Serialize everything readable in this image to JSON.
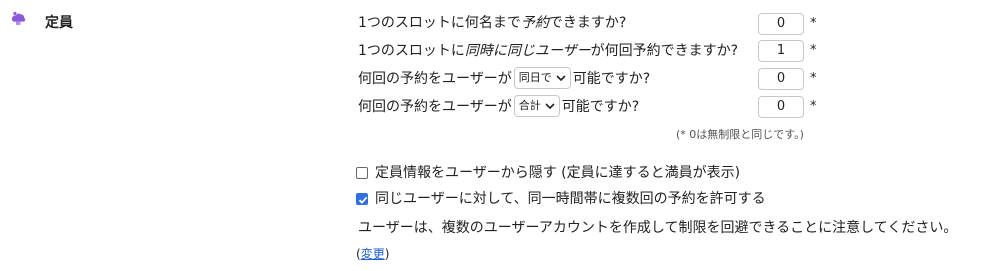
{
  "section": {
    "title": "定員",
    "icon": "puzzle-cloud-icon",
    "icon_color": "#8b5ad8"
  },
  "rows": [
    {
      "text_before": "1つのスロットに何名まで",
      "italic": "予約",
      "text_after": "できますか?",
      "value": "0",
      "required": "*"
    },
    {
      "text_before": "1つのスロットに",
      "italic": "同時に同じユーザー",
      "text_after": "が何回予約できますか?",
      "value": "1",
      "required": "*"
    },
    {
      "text_before": "何回の予約をユーザーが",
      "select_value": "同日で",
      "text_after": "可能ですか?",
      "value": "0",
      "required": "*"
    },
    {
      "text_before": "何回の予約をユーザーが",
      "select_value": "合計",
      "text_after": "可能ですか?",
      "value": "0",
      "required": "*"
    }
  ],
  "note": "(* 0は無制限と同じです。)",
  "checkboxes": [
    {
      "label": "定員情報をユーザーから隠す (定員に達すると満員が表示)",
      "checked": false
    },
    {
      "label": "同じユーザーに対して、同一時間帯に複数回の予約を許可する",
      "checked": true
    }
  ],
  "warning": "ユーザーは、複数のユーザーアカウントを作成して制限を回避できることに注意してください。",
  "change": {
    "open": "(",
    "label": "変更",
    "close": ")"
  },
  "colors": {
    "checkbox_checked": "#2f6fe0",
    "link": "#1d5fd6"
  }
}
